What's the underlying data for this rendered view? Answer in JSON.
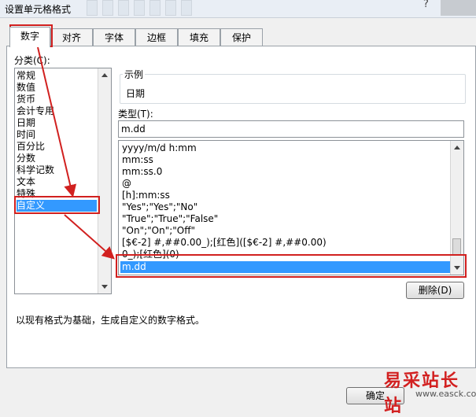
{
  "window": {
    "title": "设置单元格格式",
    "help": "?"
  },
  "tabs": [
    {
      "label": "数字",
      "active": true
    },
    {
      "label": "对齐",
      "active": false
    },
    {
      "label": "字体",
      "active": false
    },
    {
      "label": "边框",
      "active": false
    },
    {
      "label": "填充",
      "active": false
    },
    {
      "label": "保护",
      "active": false
    }
  ],
  "category": {
    "label": "分类(C):",
    "items": [
      "常规",
      "数值",
      "货币",
      "会计专用",
      "日期",
      "时间",
      "百分比",
      "分数",
      "科学记数",
      "文本",
      "特殊",
      "自定义"
    ],
    "selected": "自定义"
  },
  "sample": {
    "label": "示例",
    "value": "日期"
  },
  "type": {
    "label": "类型(T):",
    "value": "m.dd",
    "list": [
      "yyyy/m/d h:mm",
      "mm:ss",
      "mm:ss.0",
      "@",
      "[h]:mm:ss",
      "\"Yes\";\"Yes\";\"No\"",
      "\"True\";\"True\";\"False\"",
      "\"On\";\"On\";\"Off\"",
      "[$€-2] #,##0.00_);[红色]([$€-2] #,##0.00)",
      "0_);[红色](0)",
      "m.dd"
    ],
    "selected": "m.dd"
  },
  "delete_button": "删除(D)",
  "description": "以现有格式为基础，生成自定义的数字格式。",
  "ok_button": "确定",
  "watermark": {
    "text": "易采站长站",
    "url": "www.easck.com"
  },
  "colors": {
    "highlight": "#d1201f",
    "selection": "#3399ff"
  }
}
